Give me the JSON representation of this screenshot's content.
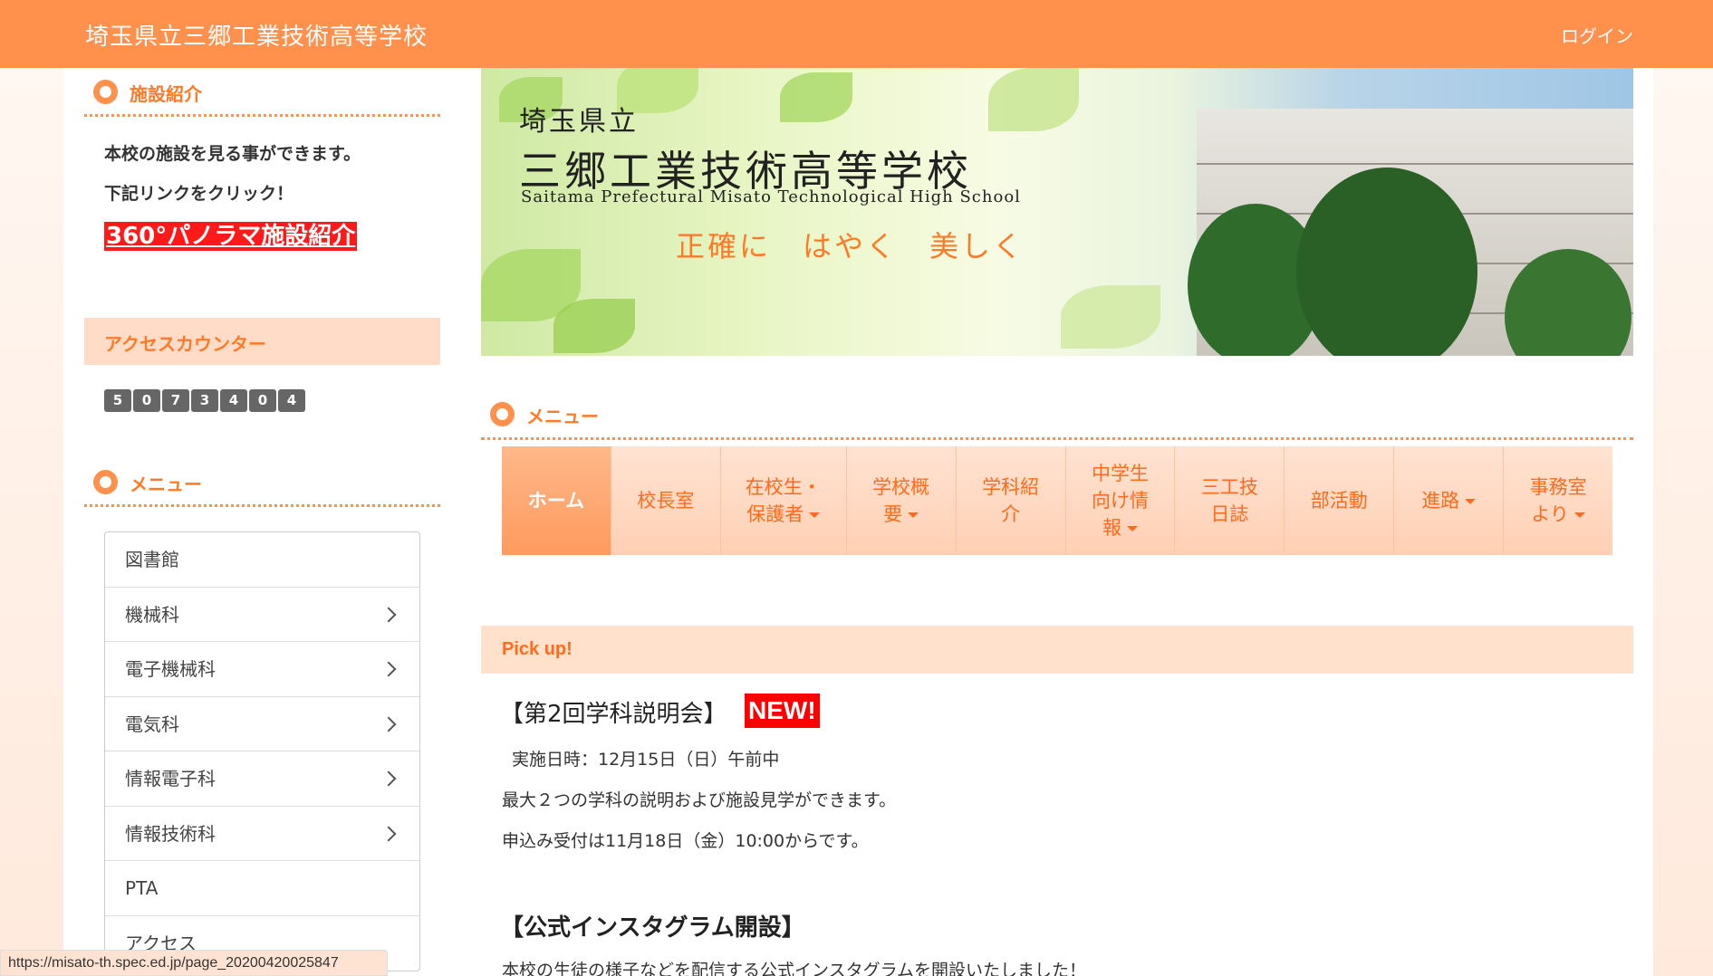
{
  "header": {
    "site_title": "埼玉県立三郷工業技術高等学校",
    "login_label": "ログイン"
  },
  "sidebar": {
    "facility_heading": "施設紹介",
    "facility_line1": "本校の施設を見る事ができます。",
    "facility_line2": "下記リンクをクリック！",
    "panorama_link": "360°パノラマ施設紹介",
    "counter_title": "アクセスカウンター",
    "counter_digits": [
      "5",
      "0",
      "7",
      "3",
      "4",
      "0",
      "4"
    ],
    "menu_heading": "メニュー",
    "menu_items": [
      {
        "label": "図書館"
      },
      {
        "label": "機械科"
      },
      {
        "label": "電子機械科"
      },
      {
        "label": "電気科"
      },
      {
        "label": "情報電子科"
      },
      {
        "label": "情報技術科"
      },
      {
        "label": "PTA"
      },
      {
        "label": "アクセス"
      }
    ]
  },
  "banner": {
    "pre_title": "埼玉県立",
    "main_title": "三郷工業技術高等学校",
    "english_title": "Saitama Prefectural Misato Technological High School",
    "motto": "正確に　はやく　美しく"
  },
  "main": {
    "menu_heading": "メニュー",
    "nav": [
      {
        "line1": "ホーム",
        "line2": "",
        "line3": ""
      },
      {
        "line1": "校長室",
        "line2": "",
        "line3": ""
      },
      {
        "line1": "在校生・",
        "line2": "保護者",
        "line3": ""
      },
      {
        "line1": "学校概",
        "line2": "要",
        "line3": ""
      },
      {
        "line1": "学科紹",
        "line2": "介",
        "line3": ""
      },
      {
        "line1": "中学生",
        "line2": "向け情",
        "line3": "報"
      },
      {
        "line1": "三工技",
        "line2": "日誌",
        "line3": ""
      },
      {
        "line1": "部活動",
        "line2": "",
        "line3": ""
      },
      {
        "line1": "進路",
        "line2": "",
        "line3": ""
      },
      {
        "line1": "事務室",
        "line2": "より",
        "line3": ""
      }
    ],
    "pickup_title": "Pick up!",
    "article1_heading": "【第2回学科説明会】",
    "new_badge": "NEW!",
    "article1_date": "実施日時：12月15日（日）午前中",
    "article1_line2": "最大２つの学科の説明および施設見学ができます。",
    "article1_line3": "申込み受付は11月18日（金）10:00からです。",
    "article2_heading": "【公式インスタグラム開設】",
    "article2_line1": "本校の生徒の様子などを配信する公式インスタグラムを開設いたしました！"
  },
  "status_url": "https://misato-th.spec.ed.jp/page_20200420025847",
  "colors": {
    "accent": "#ff914d",
    "accent_text": "#ff7a26",
    "nav_bg": "#ffd0b4",
    "new_badge": "#ff0000"
  }
}
